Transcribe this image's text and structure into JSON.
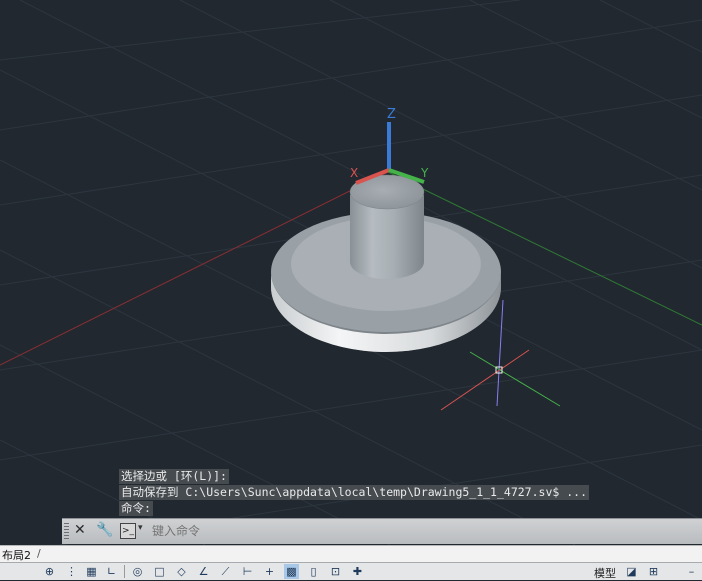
{
  "viewport": {
    "background": "#212830",
    "ucs_axis_labels": {
      "x": "X",
      "y": "Y",
      "z": "Z"
    },
    "axis_colors": {
      "x": "#d9534f",
      "y": "#46b24a",
      "z": "#3a7bd5"
    }
  },
  "command_history": [
    "选择边或 [环(L)]:",
    "自动保存到 C:\\Users\\Sunc\\appdata\\local\\temp\\Drawing5_1_1_4727.sv$ ...",
    "命令:"
  ],
  "command_line": {
    "placeholder": "键入命令",
    "close_icon": "close-icon",
    "settings_icon": "wrench-icon",
    "prompt_icon": "command-prompt-icon"
  },
  "layout_tabs": {
    "active_label": "布局2"
  },
  "status_bar": {
    "model_label": "模型",
    "tool_icons": [
      "snap-icon",
      "grid-icon",
      "grid-display-icon",
      "ortho-icon",
      "polar-icon",
      "osnap-icon",
      "3d-osnap-icon",
      "otrack-icon",
      "ducs-icon",
      "dyn-icon",
      "lineweight-icon",
      "transparency-icon",
      "qp-icon",
      "sc-icon",
      "am-icon"
    ]
  }
}
